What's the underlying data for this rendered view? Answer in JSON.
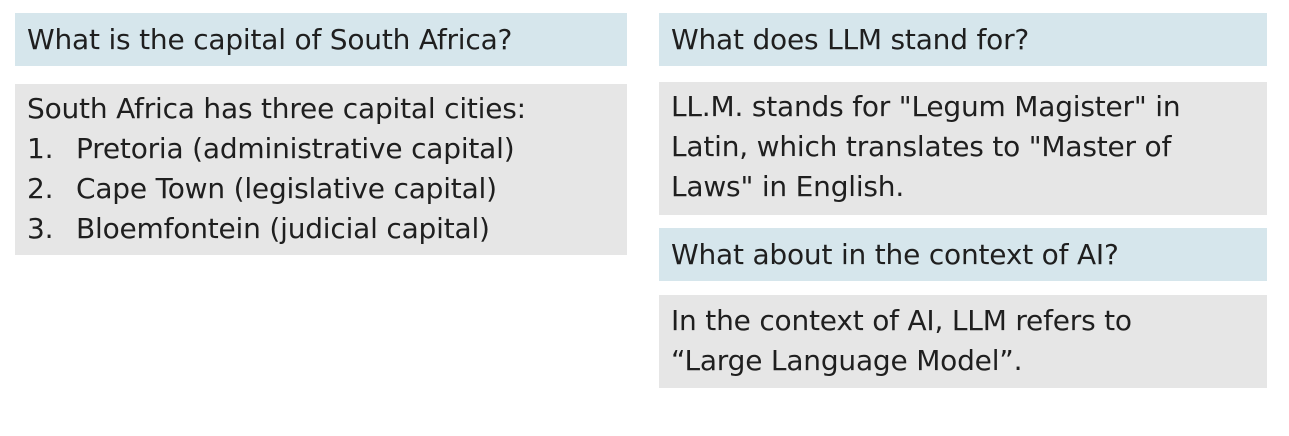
{
  "conversation_1": {
    "question": "What is the capital of South Africa?",
    "answer_intro": "South Africa has three capital cities:",
    "list": [
      {
        "num": "1.",
        "text": "Pretoria (administrative capital)"
      },
      {
        "num": "2.",
        "text": "Cape Town (legislative capital)"
      },
      {
        "num": "3.",
        "text": "Bloemfontein (judicial capital)"
      }
    ]
  },
  "conversation_2": {
    "question": "What does LLM stand for?",
    "answer_lines": [
      "LL.M. stands for \"Legum Magister\" in",
      "Latin, which translates to \"Master of",
      "Laws\" in English."
    ],
    "followup_question": "What about in the context of AI?",
    "followup_answer_lines": [
      "In the context of AI, LLM refers to",
      "“Large Language Model”."
    ]
  }
}
